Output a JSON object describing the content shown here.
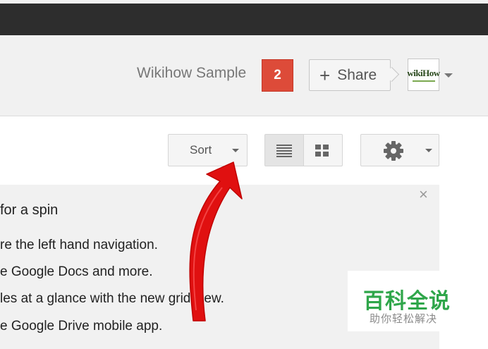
{
  "header": {
    "user_name": "Wikihow Sample",
    "notifications_count": "2",
    "share_label": "Share",
    "share_icon": "plus-icon",
    "avatar_text": "wikiHow",
    "avatar_menu_icon": "chevron-down-icon"
  },
  "toolbar": {
    "sort_label": "Sort",
    "sort_icon": "chevron-down-icon",
    "list_view_icon": "list-view-icon",
    "grid_view_icon": "grid-view-icon",
    "settings_icon": "gear-icon",
    "selected_view": "list"
  },
  "promo": {
    "title": "for a spin",
    "lines": [
      "re the left hand navigation.",
      "e Google Docs and more.",
      "les at a glance with the new grid view.",
      "e Google Drive mobile app."
    ],
    "close_symbol": "×"
  },
  "watermark": {
    "main": "百科全说",
    "sub": "助你轻松解决"
  },
  "colors": {
    "top_bar": "#2d2d2d",
    "notification": "#dd4b39",
    "arrow": "#e01010",
    "watermark_green": "#2fa64a"
  }
}
